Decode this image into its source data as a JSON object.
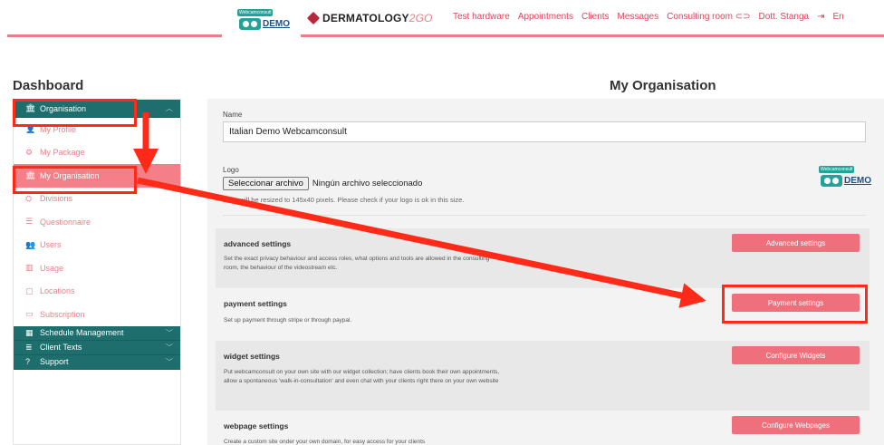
{
  "topbar": {
    "logo_small": "Webcamconsult",
    "logo_demo": "DEMO",
    "brand_name": "DERMATOLOGY",
    "brand_suffix": "2GO",
    "nav": [
      "Test hardware",
      "Appointments",
      "Clients",
      "Messages",
      "Consulting room ⊂⊃",
      "Dott. Stanga",
      "⇥",
      "En"
    ]
  },
  "dashboard_title": "Dashboard",
  "page_title": "My Organisation",
  "sidebar": {
    "organisation_header": "Organisation",
    "items": [
      {
        "label": "My Profile",
        "icon": "person-icon"
      },
      {
        "label": "My Package",
        "icon": "gears-icon"
      },
      {
        "label": "My Organisation",
        "icon": "bank-icon",
        "active": true
      },
      {
        "label": "Divisions",
        "icon": "sitemap-icon"
      },
      {
        "label": "Questionnaire",
        "icon": "list-icon"
      },
      {
        "label": "Users",
        "icon": "users-icon"
      },
      {
        "label": "Usage",
        "icon": "bar-chart-icon"
      },
      {
        "label": "Locations",
        "icon": "map-icon"
      },
      {
        "label": "Subscription",
        "icon": "card-icon"
      }
    ],
    "groups": [
      {
        "label": "Schedule Management",
        "icon": "calendar-icon"
      },
      {
        "label": "Client Texts",
        "icon": "text-icon"
      },
      {
        "label": "Support",
        "icon": "help-icon"
      }
    ]
  },
  "form": {
    "name_label": "Name",
    "name_value": "Italian Demo Webcamconsult",
    "logo_label": "Logo",
    "file_button": "Seleccionar archivo",
    "file_status": "Ningún archivo seleccionado",
    "logo_hint": "Logo will be resized to 145x40 pixels. Please check if your logo is ok in this size."
  },
  "settings": [
    {
      "title": "advanced settings",
      "desc": "Set the exact privacy behaviour and access roles, what options and tools are allowed in the consulting room, the behaviour of the videostream etc.",
      "button": "Advanced settings"
    },
    {
      "title": "payment settings",
      "desc": "Set up payment through stripe or through paypal.",
      "button": "Payment settings"
    },
    {
      "title": "widget settings",
      "desc": "Put webcamconsult on your own site with our widget collection; have clients book their own appointments, allow a spontaneous 'walk-in-consultation' and even chat with your clients right there on your own website",
      "button": "Configure Widgets"
    },
    {
      "title": "webpage settings",
      "desc": "Create a custom site onder your own domain, for easy access for your clients",
      "button": "Configure Webpages"
    }
  ],
  "colors": {
    "accent": "#f06f7d",
    "sidebar_header": "#1d6e6c",
    "annotation": "#ff2a18"
  }
}
